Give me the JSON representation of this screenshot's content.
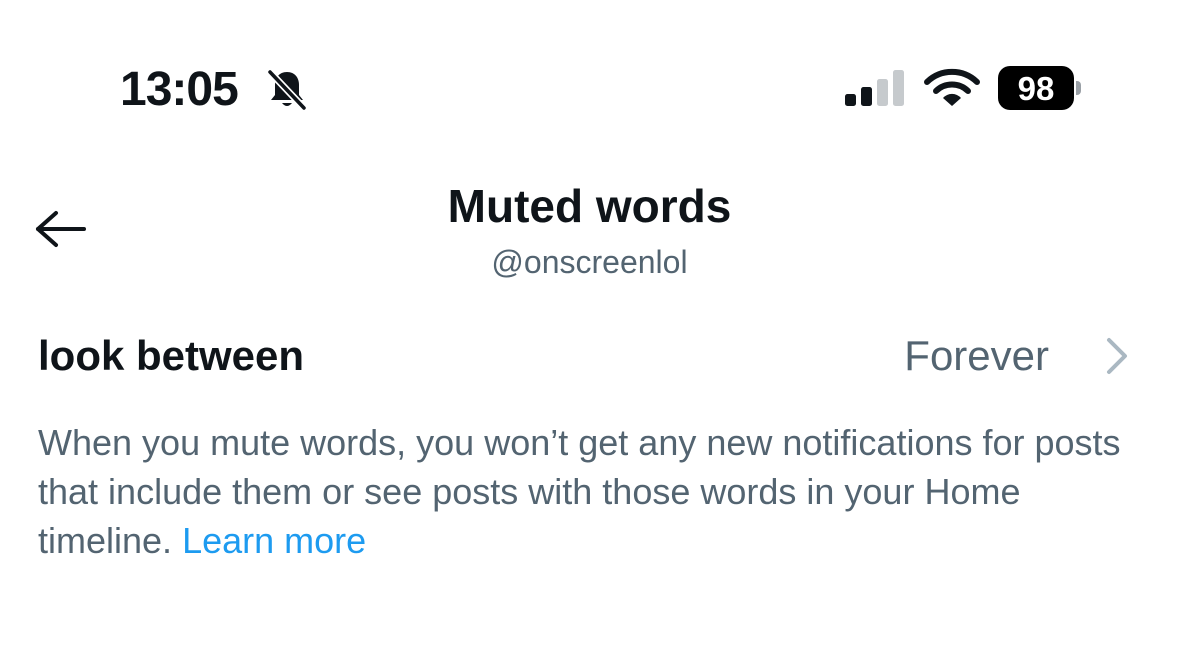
{
  "status_bar": {
    "time": "13:05",
    "battery": "98",
    "icons": [
      "bell-slash-icon",
      "signal-icon",
      "wifi-icon",
      "battery-icon"
    ]
  },
  "header": {
    "title": "Muted words",
    "subtitle": "@onscreenlol",
    "back_icon": "arrow-left-icon"
  },
  "muted_word": {
    "word": "look between",
    "duration": "Forever",
    "chevron_icon": "chevron-right-icon"
  },
  "description": {
    "text": "When you mute words, you won’t get any new notifications for posts that include them or see posts with those words in your Home timeline. ",
    "link": "Learn more"
  },
  "colors": {
    "primary_text": "#0f1419",
    "secondary_text": "#536471",
    "link": "#1d9bf0",
    "chevron": "#aab8c2"
  }
}
